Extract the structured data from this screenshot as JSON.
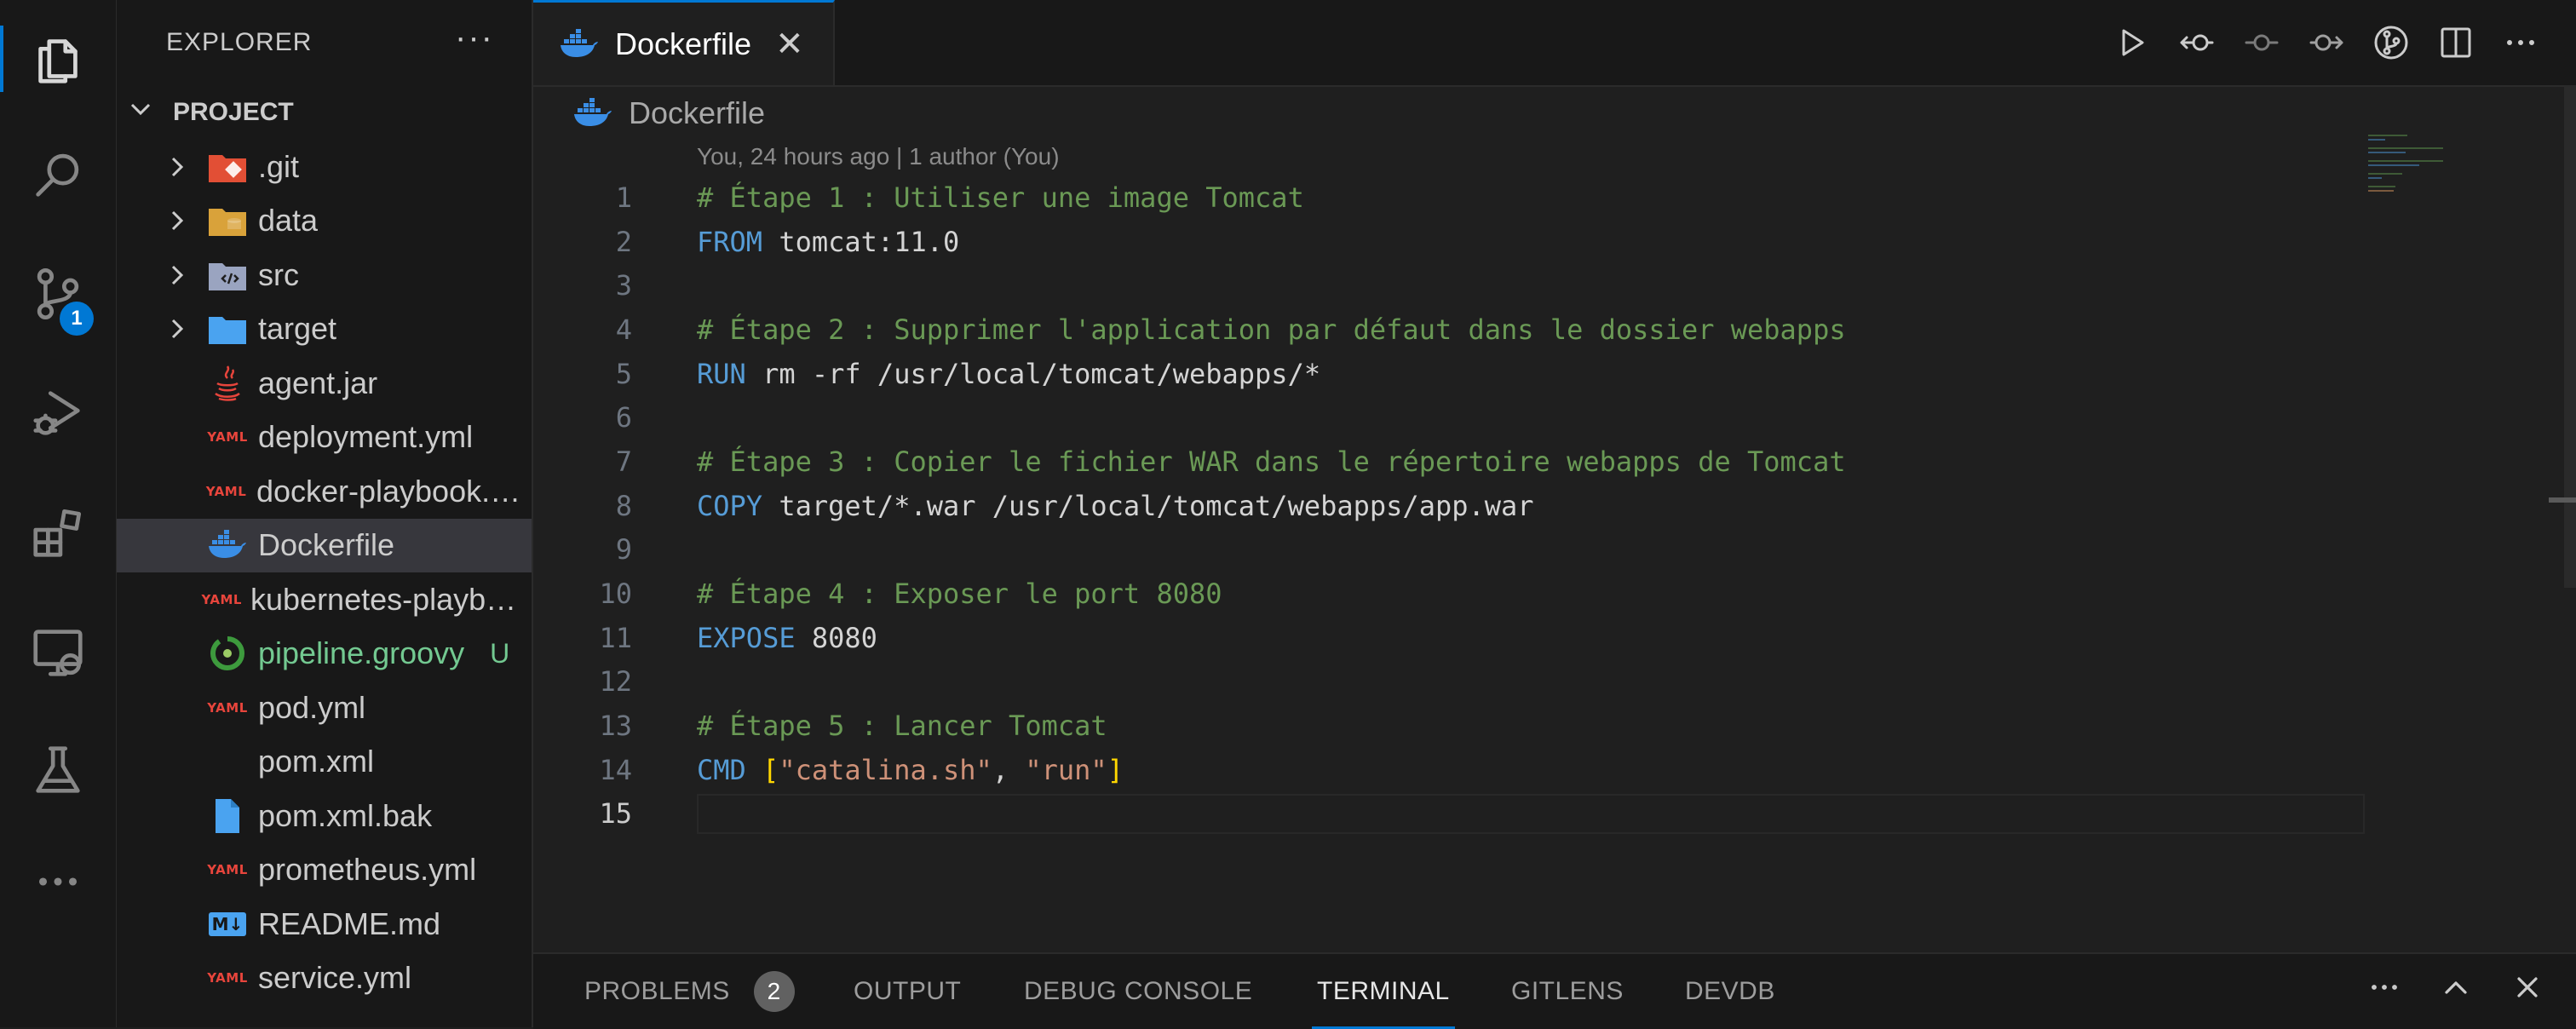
{
  "activity_bar": {
    "items": [
      {
        "name": "explorer-icon",
        "active": true
      },
      {
        "name": "search-icon"
      },
      {
        "name": "source-control-icon",
        "badge": "1"
      },
      {
        "name": "run-debug-icon"
      },
      {
        "name": "extensions-icon"
      },
      {
        "name": "remote-explorer-icon"
      },
      {
        "name": "testing-icon"
      },
      {
        "name": "more-icon"
      }
    ]
  },
  "sidebar": {
    "title": "EXPLORER",
    "more": "···",
    "section": "PROJECT",
    "items": [
      {
        "label": ".git",
        "icon": "git-folder-icon",
        "folder": true
      },
      {
        "label": "data",
        "icon": "database-folder-icon",
        "folder": true
      },
      {
        "label": "src",
        "icon": "source-folder-icon",
        "folder": true
      },
      {
        "label": "target",
        "icon": "folder-icon",
        "folder": true
      },
      {
        "label": "agent.jar",
        "icon": "java-icon"
      },
      {
        "label": "deployment.yml",
        "icon": "yaml-icon",
        "icon_text": "YAML"
      },
      {
        "label": "docker-playbook.yml",
        "icon": "yaml-icon",
        "icon_text": "YAML"
      },
      {
        "label": "Dockerfile",
        "icon": "docker-icon",
        "selected": true
      },
      {
        "label": "kubernetes-playbook.yml",
        "icon": "yaml-icon",
        "icon_text": "YAML"
      },
      {
        "label": "pipeline.groovy",
        "icon": "pipeline-icon",
        "status": "U"
      },
      {
        "label": "pod.yml",
        "icon": "yaml-icon",
        "icon_text": "YAML"
      },
      {
        "label": "pom.xml",
        "icon": "xml-icon",
        "icon_text": "</>"
      },
      {
        "label": "pom.xml.bak",
        "icon": "file-icon"
      },
      {
        "label": "prometheus.yml",
        "icon": "yaml-icon",
        "icon_text": "YAML"
      },
      {
        "label": "README.md",
        "icon": "markdown-icon",
        "icon_text": "M↓"
      },
      {
        "label": "service.yml",
        "icon": "yaml-icon",
        "icon_text": "YAML"
      }
    ]
  },
  "editor": {
    "tab": {
      "label": "Dockerfile",
      "close": "✕"
    },
    "breadcrumb": "Dockerfile",
    "blame": "You, 24 hours ago | 1 author (You)",
    "lines": [
      [
        {
          "t": "# Étape 1 : Utiliser une image Tomcat",
          "c": "comment"
        }
      ],
      [
        {
          "t": "FROM",
          "c": "kw"
        },
        {
          "t": " tomcat:11.0",
          "c": "plain"
        }
      ],
      [],
      [
        {
          "t": "# Étape 2 : Supprimer l'application par défaut dans le dossier webapps",
          "c": "comment"
        }
      ],
      [
        {
          "t": "RUN",
          "c": "kw"
        },
        {
          "t": " rm -rf /usr/local/tomcat/webapps/*",
          "c": "plain"
        }
      ],
      [],
      [
        {
          "t": "# Étape 3 : Copier le fichier WAR dans le répertoire webapps de Tomcat",
          "c": "comment"
        }
      ],
      [
        {
          "t": "COPY",
          "c": "kw"
        },
        {
          "t": " target/*.war /usr/local/tomcat/webapps/app.war",
          "c": "plain"
        }
      ],
      [],
      [
        {
          "t": "# Étape 4 : Exposer le port 8080",
          "c": "comment"
        }
      ],
      [
        {
          "t": "EXPOSE",
          "c": "kw"
        },
        {
          "t": " 8080",
          "c": "plain"
        }
      ],
      [],
      [
        {
          "t": "# Étape 5 : Lancer Tomcat",
          "c": "comment"
        }
      ],
      [
        {
          "t": "CMD",
          "c": "kw"
        },
        {
          "t": " ",
          "c": "plain"
        },
        {
          "t": "[",
          "c": "bracket"
        },
        {
          "t": "\"catalina.sh\"",
          "c": "str"
        },
        {
          "t": ", ",
          "c": "plain"
        },
        {
          "t": "\"run\"",
          "c": "str"
        },
        {
          "t": "]",
          "c": "bracket"
        }
      ],
      []
    ],
    "current_line": 15,
    "toolbar": [
      "run-icon",
      "previous-change-icon",
      "timeline-icon",
      "next-change-icon",
      "git-graph-icon",
      "split-editor-icon",
      "more-actions-icon"
    ]
  },
  "panel": {
    "tabs": [
      {
        "label": "PROBLEMS",
        "badge": "2"
      },
      {
        "label": "OUTPUT"
      },
      {
        "label": "DEBUG CONSOLE"
      },
      {
        "label": "TERMINAL",
        "active": true
      },
      {
        "label": "GITLENS"
      },
      {
        "label": "DEVDB"
      }
    ],
    "actions": [
      "more-actions-icon",
      "maximize-panel-icon",
      "close-panel-icon"
    ]
  },
  "colors": {
    "accent": "#0078d4",
    "comment": "#6a9955",
    "keyword": "#569cd6",
    "string": "#ce9178",
    "untracked": "#73c991"
  }
}
